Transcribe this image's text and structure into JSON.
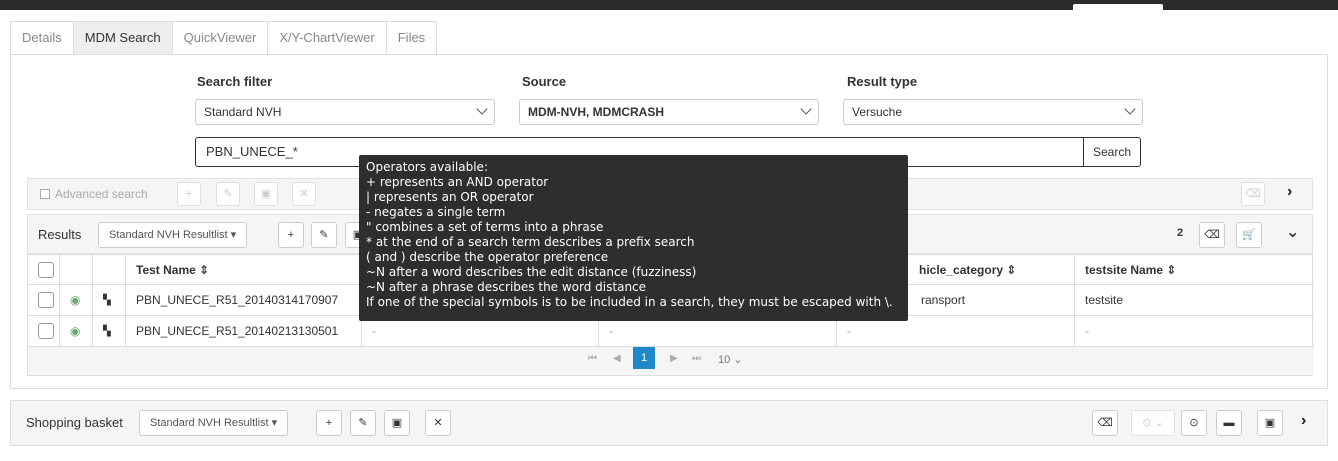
{
  "tabs": [
    "Details",
    "MDM Search",
    "QuickViewer",
    "X/Y-ChartViewer",
    "Files"
  ],
  "active_tab": "MDM Search",
  "filters": {
    "search_filter_label": "Search filter",
    "search_filter_value": "Standard NVH",
    "source_label": "Source",
    "source_value": "MDM-NVH, MDMCRASH",
    "result_type_label": "Result type",
    "result_type_value": "Versuche"
  },
  "search": {
    "query": "PBN_UNECE_*",
    "button_label": "Search"
  },
  "advanced": {
    "label": "Advanced search"
  },
  "results": {
    "title": "Results",
    "resultlist_label": "Standard NVH Resultlist",
    "count": "2",
    "columns": [
      "Test Name",
      "vehicle_category",
      "testsite Name"
    ],
    "col1_visible": "Test Name",
    "col_vehicle_visible": "hicle_category",
    "col_testsite": "testsite Name",
    "sort_glyph": "⇕",
    "rows": [
      {
        "test_name": "PBN_UNECE_R51_20140314170907",
        "vehicle_visible": "ransport",
        "testsite": "testsite"
      },
      {
        "test_name": "PBN_UNECE_R51_20140213130501",
        "c2": "-",
        "c3": "-",
        "vehicle": "-",
        "testsite": "-"
      }
    ],
    "pager": {
      "current_page": "1",
      "page_size": "10"
    }
  },
  "basket": {
    "title": "Shopping basket",
    "resultlist_label": "Standard NVH Resultlist"
  },
  "tooltip": {
    "lines": [
      "Operators available:",
      "+ represents an AND operator",
      "| represents an OR operator",
      "- negates a single term",
      "\" combines a set of terms into a phrase",
      "* at the end of a search term describes a prefix search",
      "( and ) describe the operator preference",
      "~N after a word describes the edit distance (fuzziness)",
      "~N after a phrase describes the word distance",
      "If one of the special symbols is to be included in a search, they must be escaped with \\."
    ]
  },
  "icons": {
    "plus": "+",
    "edit": "✎",
    "save": "▣",
    "close": "✕",
    "eraser": "⌫",
    "cart": "🛒",
    "chevron_right": "›",
    "chevron_down": "⌄",
    "folder": "▬",
    "circle_dot": "⊙"
  },
  "colors": {
    "accent": "#1e88c8",
    "tooltip_bg": "#2e2e2e"
  }
}
